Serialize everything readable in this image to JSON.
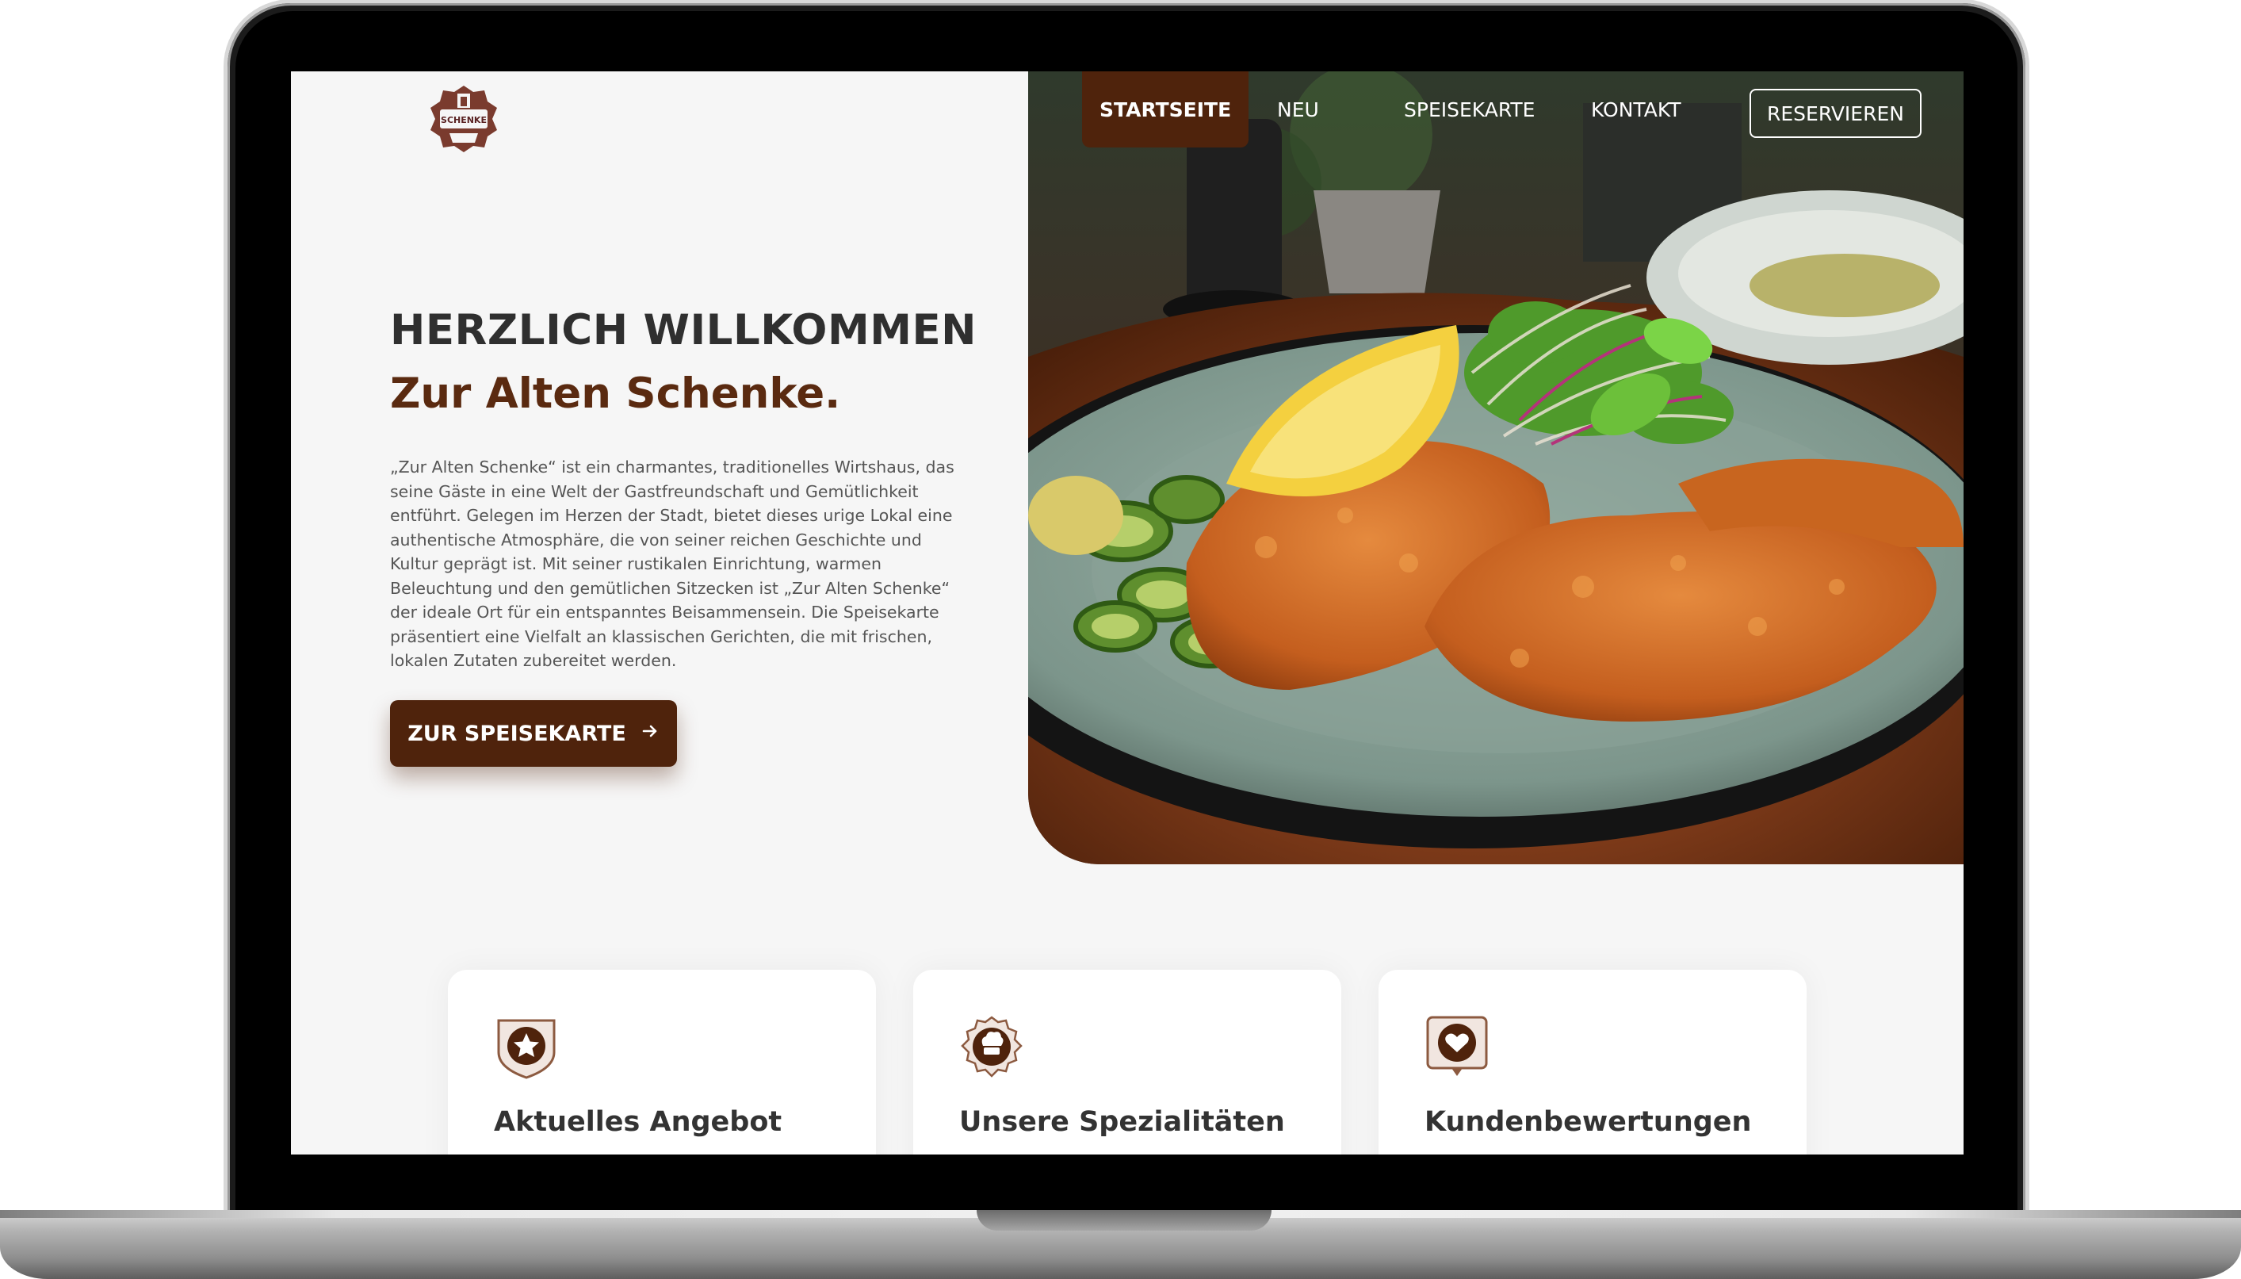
{
  "brand": {
    "logo_text": "SCHENKE"
  },
  "nav": {
    "items": [
      {
        "label": "STARTSEITE",
        "active": true
      },
      {
        "label": "NEU",
        "active": false
      },
      {
        "label": "SPEISEKARTE",
        "active": false
      },
      {
        "label": "KONTAKT",
        "active": false
      }
    ],
    "reserve_label": "RESERVIEREN"
  },
  "hero": {
    "title": "HERZLICH WILLKOMMEN",
    "subtitle": "Zur Alten Schenke.",
    "intro": "„Zur Alten Schenke“ ist ein charmantes, traditionelles Wirtshaus, das seine Gäste in eine Welt der Gastfreundschaft und Gemütlichkeit entführt. Gelegen im Herzen der Stadt, bietet dieses urige Lokal eine authentische Atmosphäre, die von seiner reichen Geschichte und Kultur geprägt ist. Mit seiner rustikalen Einrichtung, warmen Beleuchtung und den gemütlichen Sitzecken ist „Zur Alten Schenke“ der ideale Ort für ein entspanntes Beisammensein. Die Speisekarte präsentiert eine Vielfalt an klassischen Gerichten, die mit frischen, lokalen Zutaten zubereitet werden.",
    "cta_label": "ZUR SPEISEKARTE",
    "cta_icon": "arrow-right-icon",
    "image": "schnitzel-plate-photo"
  },
  "features": [
    {
      "title": "Aktuelles Angebot",
      "icon": "star-badge-icon"
    },
    {
      "title": "Unsere Spezialitäten",
      "icon": "chef-hat-badge-icon"
    },
    {
      "title": "Kundenbewertungen",
      "icon": "heart-speech-icon"
    }
  ],
  "colors": {
    "accent": "#4f230c",
    "title_dark": "#2f2f2f",
    "subtitle_brown": "#5a2a10",
    "page_bg": "#f6f6f6"
  }
}
